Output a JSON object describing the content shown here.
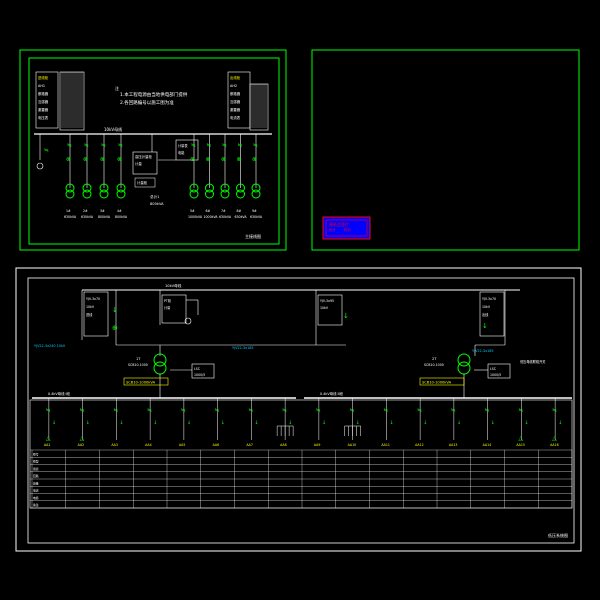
{
  "colors": {
    "background": "#000000",
    "frame": "#00ff00",
    "wire": "#ffffff",
    "label": "#ffff00",
    "equipment": "#00ff00",
    "accent_red": "#ff0000",
    "accent_blue": "#0000ff",
    "teal": "#00ffcc"
  },
  "sheets": {
    "top_left": {
      "note_line1": "1.本工程电源由当地供电部门提供",
      "note_line2": "2.各回路编号以施工图为准",
      "bus_label": "10kV母线",
      "center_box_top": "高压计量柜",
      "center_box_mid": "计量",
      "center_label": "计量柜",
      "center_bottom_label": "总计1",
      "center_bottom_sub": "800kVA",
      "left_feeders": [
        {
          "code": "1#",
          "rating": "630kVA"
        },
        {
          "code": "2#",
          "rating": "630kVA"
        },
        {
          "code": "3#",
          "rating": "800kVA"
        },
        {
          "code": "4#",
          "rating": "800kVA"
        }
      ],
      "right_feeders": [
        {
          "code": "5#",
          "rating": "1000kVA"
        },
        {
          "code": "6#",
          "rating": "1000kVA"
        },
        {
          "code": "7#",
          "rating": "630kVA"
        },
        {
          "code": "8#",
          "rating": "630kVA"
        },
        {
          "code": "9#",
          "rating": "630kVA"
        }
      ],
      "left_panel_lines": [
        "进线柜",
        "AH1",
        "断路器",
        "互感器",
        "避雷器",
        "电压表"
      ],
      "right_panel_lines": [
        "出线柜",
        "AH2",
        "断路器",
        "互感器",
        "避雷器",
        "电流表"
      ],
      "title_block": "主接线图"
    },
    "top_right": {
      "stamp_line1": "图纸会签栏",
      "stamp_line2": "设计",
      "stamp_line3": "校对"
    },
    "bottom": {
      "top_bus_label": "10kV母线",
      "left_box_lines": [
        "YJV-3x70",
        "10kV",
        "进线"
      ],
      "mid_box_lines": [
        "PT柜",
        "计量"
      ],
      "right_box_lines": [
        "YJV-3x95",
        "10kV"
      ],
      "far_right_box_lines": [
        "YJV-3x70",
        "10kV",
        "出线"
      ],
      "cable_left": "YJV22-3x240 10kV",
      "cable_mid": "YJV22-3x185",
      "cable_right": "YJV22-3x185",
      "tx_left_label": "1T",
      "tx_left_rating": "SCB10-1000",
      "tx_right_label": "2T",
      "tx_right_rating": "SCB10-1000",
      "tx_left_box": [
        "LSC",
        "1000/5"
      ],
      "tx_right_box": [
        "LSC",
        "1000/5"
      ],
      "tx_left_tag": "SCB10-1000kVA",
      "tx_right_tag": "SCB10-1000kVA",
      "right_note": "低压母线联络开关",
      "lv_bus_left": "0.4kV母线 I段",
      "lv_bus_right": "0.4kV母线 II段",
      "title_block": "低压系统图",
      "row_labels": [
        "柜号",
        "柜型",
        "用途",
        "回路",
        "容量",
        "电流",
        "电缆",
        "备注"
      ],
      "columns": [
        "AA1",
        "AA2",
        "AA3",
        "AA4",
        "AA5",
        "AA6",
        "AA7",
        "AA8",
        "AA9",
        "AA10",
        "AA11",
        "AA12",
        "AA13",
        "AA14",
        "AA15",
        "AA16"
      ]
    }
  }
}
